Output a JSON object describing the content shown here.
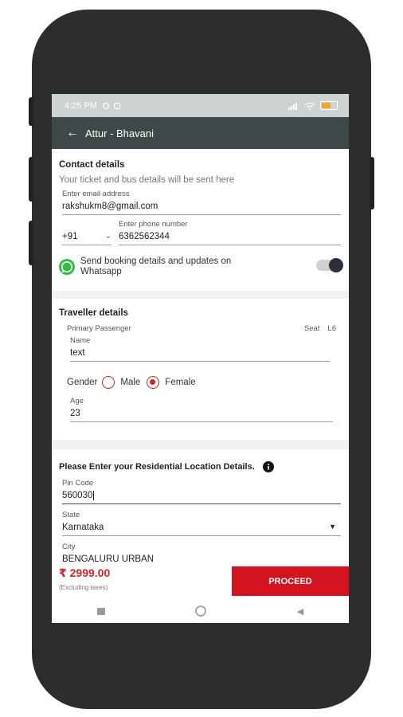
{
  "status_bar": {
    "time": "4:25 PM",
    "battery_color": "#f5a623"
  },
  "toolbar": {
    "title": "Attur - Bhavani",
    "bg_color": "#3e4848"
  },
  "contact": {
    "title": "Contact details",
    "subtitle": "Your ticket and bus details will be sent here",
    "email_label": "Enter email address",
    "email_value": "rakshukm8@gmail.com",
    "phone_label": "Enter phone number",
    "country_code": "+91",
    "phone_value": "6362562344",
    "whatsapp_text": "Send booking details and updates on Whatsapp",
    "whatsapp_enabled": true
  },
  "traveller": {
    "title": "Traveller details",
    "primary_label": "Primary Passenger",
    "seat_label": "Seat",
    "seat_value": "L6",
    "name_label": "Name",
    "name_value": "text",
    "gender_label": "Gender",
    "gender_male": "Male",
    "gender_female": "Female",
    "gender_selected": "Female",
    "age_label": "Age",
    "age_value": "23"
  },
  "residential": {
    "title": "Please Enter your Residential Location Details.",
    "pin_label": "Pin Code",
    "pin_value": "560030",
    "state_label": "State",
    "state_value": "Karnataka",
    "city_label": "City",
    "city_value": "BENGALURU URBAN"
  },
  "bottom": {
    "price": "₹ 2999.00",
    "excluding": "(Excluding taxes)",
    "proceed_label": "PROCEED",
    "accent_color": "#d3141f"
  }
}
